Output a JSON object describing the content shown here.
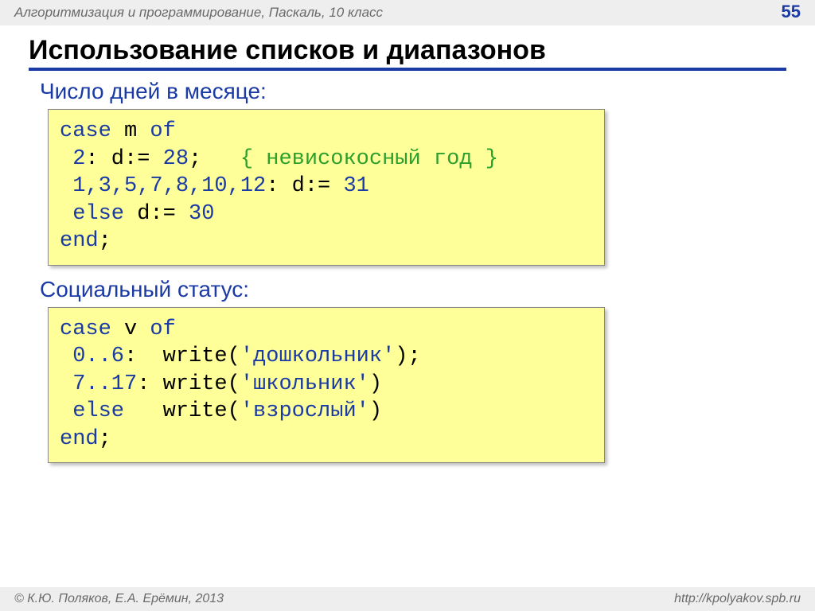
{
  "header": {
    "course": "Алгоритмизация и программирование, Паскаль, 10 класс",
    "page": "55"
  },
  "title": "Использование списков и диапазонов",
  "section1": {
    "heading": "Число дней в месяце:",
    "code": {
      "l1_case": "case",
      "l1_rest": " m ",
      "l1_of": "of",
      "l2_num": " 2",
      "l2_mid": ": d:= ",
      "l2_val": "28",
      "l2_semi": ";   ",
      "l2_comment": "{ невисокосный год }",
      "l3_nums": " 1,3,5,7,8,10,12",
      "l3_mid": ": d:= ",
      "l3_val": "31",
      "l4_else": " else",
      "l4_mid": " d:= ",
      "l4_val": "30",
      "l5_end": "end",
      "l5_semi": ";"
    }
  },
  "section2": {
    "heading": "Социальный статус:",
    "code": {
      "l1_case": "case",
      "l1_rest": " v ",
      "l1_of": "of",
      "l2_range": " 0..6",
      "l2_mid": ":  write(",
      "l2_str": "'дошкольник'",
      "l2_end": ");",
      "l3_range": " 7..17",
      "l3_mid": ": write(",
      "l3_str": "'школьник'",
      "l3_end": ")",
      "l4_else": " else",
      "l4_mid": "   write(",
      "l4_str": "'взрослый'",
      "l4_end": ")",
      "l5_end": "end",
      "l5_semi": ";"
    }
  },
  "footer": {
    "left": "© К.Ю. Поляков, Е.А. Ерёмин, 2013",
    "right": "http://kpolyakov.spb.ru"
  }
}
